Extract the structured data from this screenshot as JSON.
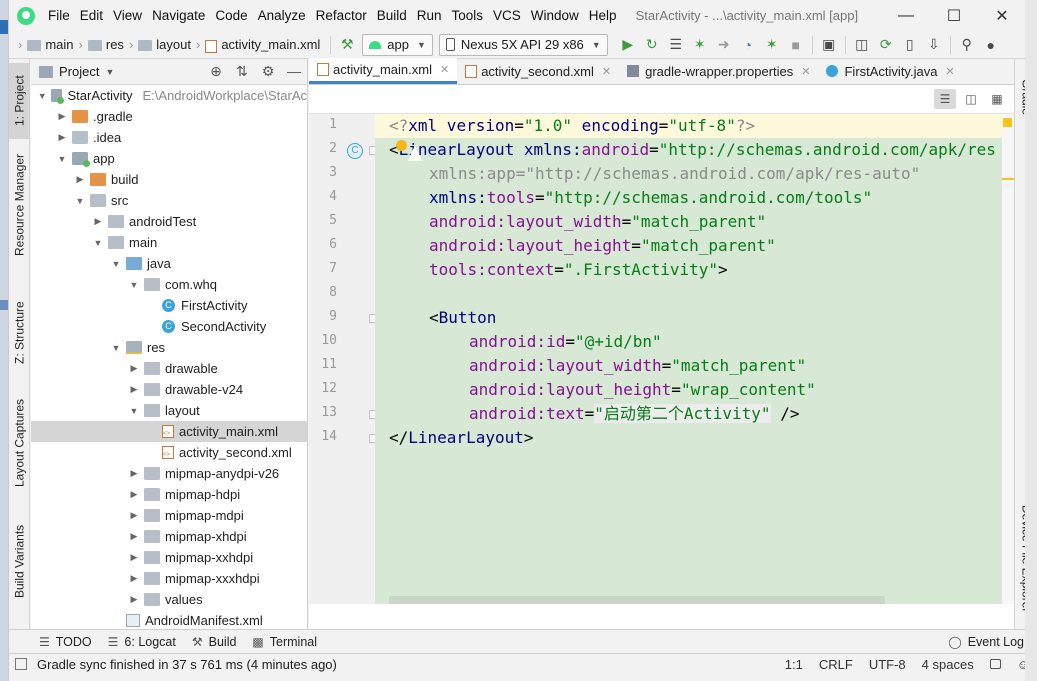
{
  "menubar": {
    "items": [
      "File",
      "Edit",
      "View",
      "Navigate",
      "Code",
      "Analyze",
      "Refactor",
      "Build",
      "Run",
      "Tools",
      "VCS",
      "Window",
      "Help"
    ],
    "window_title": "StarActivity - ...\\activity_main.xml [app]"
  },
  "toolbar": {
    "breadcrumbs": [
      "main",
      "res",
      "layout",
      "activity_main.xml"
    ],
    "run_config": "app",
    "device": "Nexus 5X API 29 x86"
  },
  "left_tools": {
    "project": "1: Project",
    "resource_manager": "Resource Manager",
    "structure": "Z: Structure",
    "layout_captures": "Layout Captures",
    "build_variants": "Build Variants"
  },
  "right_tools": {
    "gradle": "Gradle",
    "device_file_explorer": "Device File Explorer"
  },
  "project_panel": {
    "title": "Project",
    "root_name": "StarActivity",
    "root_path": "E:\\AndroidWorkplace\\StarAc",
    "items": [
      {
        "label": ".gradle"
      },
      {
        "label": ".idea"
      },
      {
        "label": "app"
      },
      {
        "label": "build"
      },
      {
        "label": "src"
      },
      {
        "label": "androidTest"
      },
      {
        "label": "main"
      },
      {
        "label": "java"
      },
      {
        "label": "com.whq"
      },
      {
        "label": "FirstActivity"
      },
      {
        "label": "SecondActivity"
      },
      {
        "label": "res"
      },
      {
        "label": "drawable"
      },
      {
        "label": "drawable-v24"
      },
      {
        "label": "layout"
      },
      {
        "label": "activity_main.xml"
      },
      {
        "label": "activity_second.xml"
      },
      {
        "label": "mipmap-anydpi-v26"
      },
      {
        "label": "mipmap-hdpi"
      },
      {
        "label": "mipmap-mdpi"
      },
      {
        "label": "mipmap-xhdpi"
      },
      {
        "label": "mipmap-xxhdpi"
      },
      {
        "label": "mipmap-xxxhdpi"
      },
      {
        "label": "values"
      },
      {
        "label": "AndroidManifest.xml"
      }
    ]
  },
  "editor": {
    "tabs": [
      "activity_main.xml",
      "activity_second.xml",
      "gradle-wrapper.properties",
      "FirstActivity.java"
    ],
    "line_numbers": [
      "1",
      "2",
      "3",
      "4",
      "5",
      "6",
      "7",
      "8",
      "9",
      "10",
      "11",
      "12",
      "13",
      "14"
    ],
    "code": {
      "l1": {
        "a": "<?",
        "b": "xml",
        "c": " version",
        "d": "=",
        "e": "\"1.0\"",
        "f": " encoding",
        "g": "=",
        "h": "\"utf-8\"",
        "i": "?>"
      },
      "l2": {
        "a": "<",
        "b": "LinearLayout",
        "c": " xmlns:",
        "d": "android",
        "e": "=",
        "f": "\"http://schemas.android.com/apk/res"
      },
      "l3": {
        "a": "xmlns:app",
        "b": "=",
        "c": "\"http://schemas.android.com/apk/res-auto\""
      },
      "l4": {
        "a": "xmlns:",
        "b": "tools",
        "c": "=",
        "d": "\"http://schemas.android.com/tools\""
      },
      "l5": {
        "a": "android:",
        "b": "layout_width",
        "c": "=",
        "d": "\"match_parent\""
      },
      "l6": {
        "a": "android:",
        "b": "layout_height",
        "c": "=",
        "d": "\"match_parent\""
      },
      "l7": {
        "a": "tools:",
        "b": "context",
        "c": "=",
        "d": "\".FirstActivity\"",
        "e": ">"
      },
      "l9": {
        "a": "<",
        "b": "Button"
      },
      "l10": {
        "a": "android:",
        "b": "id",
        "c": "=",
        "d": "\"@+id/bn\""
      },
      "l11": {
        "a": "android:",
        "b": "layout_width",
        "c": "=",
        "d": "\"match_parent\""
      },
      "l12": {
        "a": "android:",
        "b": "layout_height",
        "c": "=",
        "d": "\"wrap_content\""
      },
      "l13": {
        "a": "android:",
        "b": "text",
        "c": "=",
        "d": "\"启动第二个Activity\"",
        "e": " />"
      },
      "l14": {
        "a": "</",
        "b": "LinearLayout",
        "c": ">"
      }
    }
  },
  "bottom_tools": {
    "todo": "TODO",
    "logcat": "6: Logcat",
    "build": "Build",
    "terminal": "Terminal",
    "event_log": "Event Log"
  },
  "status": {
    "message": "Gradle sync finished in 37 s 761 ms (4 minutes ago)",
    "position": "1:1",
    "line_sep": "CRLF",
    "encoding": "UTF-8",
    "indent": "4 spaces"
  }
}
